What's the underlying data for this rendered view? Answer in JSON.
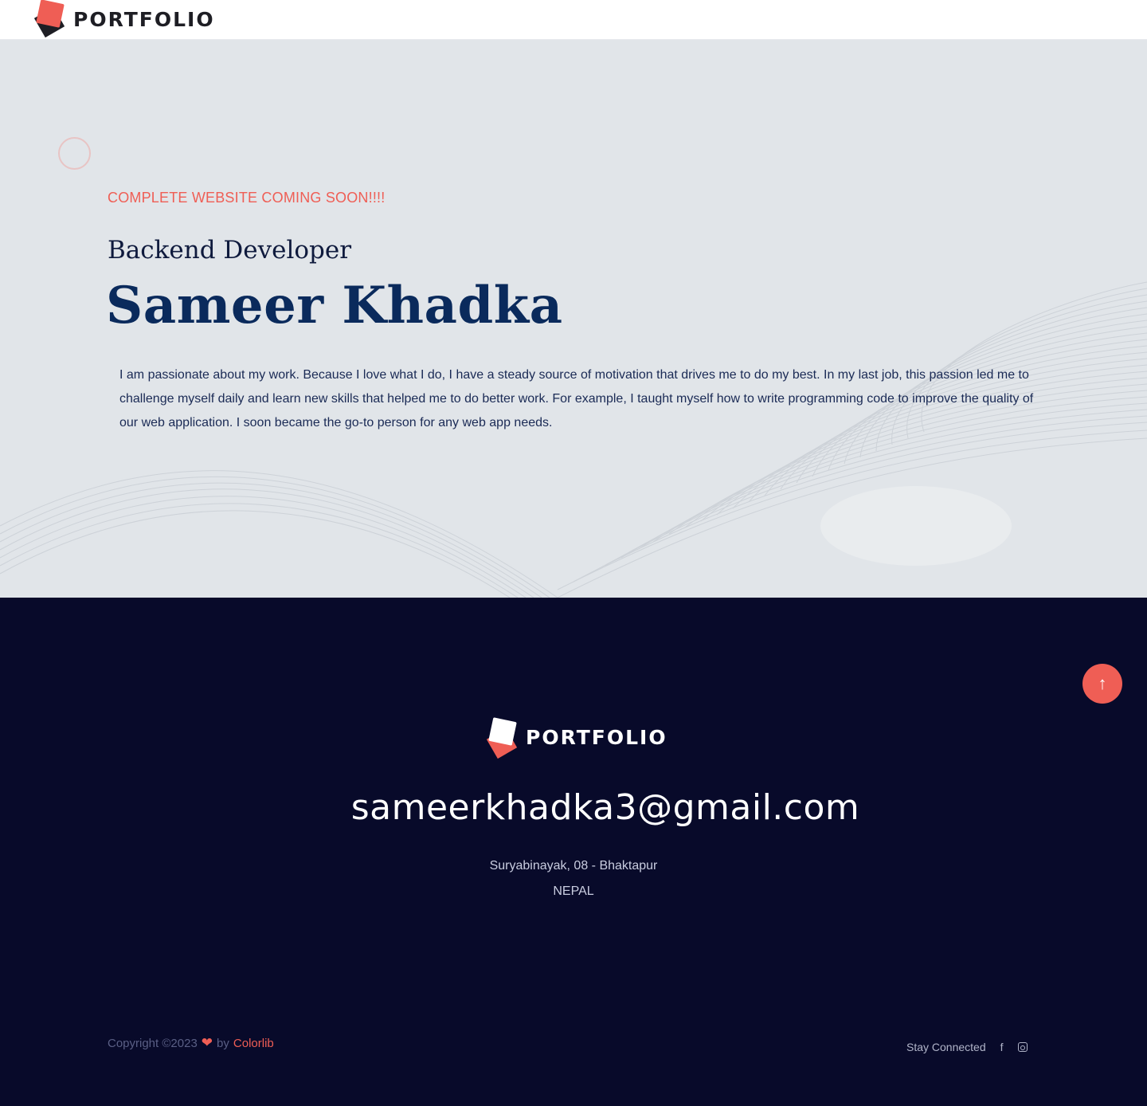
{
  "header": {
    "logo_text": "PORTFOLIO"
  },
  "hero": {
    "tagline": "COMPLETE WEBSITE COMING SOON!!!!",
    "role": "Backend Developer",
    "name": "Sameer Khadka",
    "bio": "I am passionate about my work. Because I love what I do, I have a steady source of motivation that drives me to do my best. In my last job, this passion led me to challenge myself daily and learn new skills that helped me to do better work. For example, I taught myself how to write programming code to improve the quality of our web application. I soon became the go-to person for any web app needs."
  },
  "footer": {
    "logo_text": "PORTFOLIO",
    "email": "sameerkhadka3@gmail.com",
    "address_line1": "Suryabinayak, 08 - Bhaktapur",
    "address_line2": "NEPAL",
    "copyright_prefix": "Copyright ©2023",
    "by_text": "by",
    "credit_link": "Colorlib",
    "stay_connected": "Stay Connected",
    "icons": [
      "facebook-icon",
      "instagram-icon",
      "heart-icon",
      "arrow-up-icon"
    ]
  },
  "colors": {
    "accent": "#ef5e55",
    "navy": "#0a2a5c",
    "footer_bg": "#080a2a",
    "hero_bg": "#e1e5e9"
  }
}
